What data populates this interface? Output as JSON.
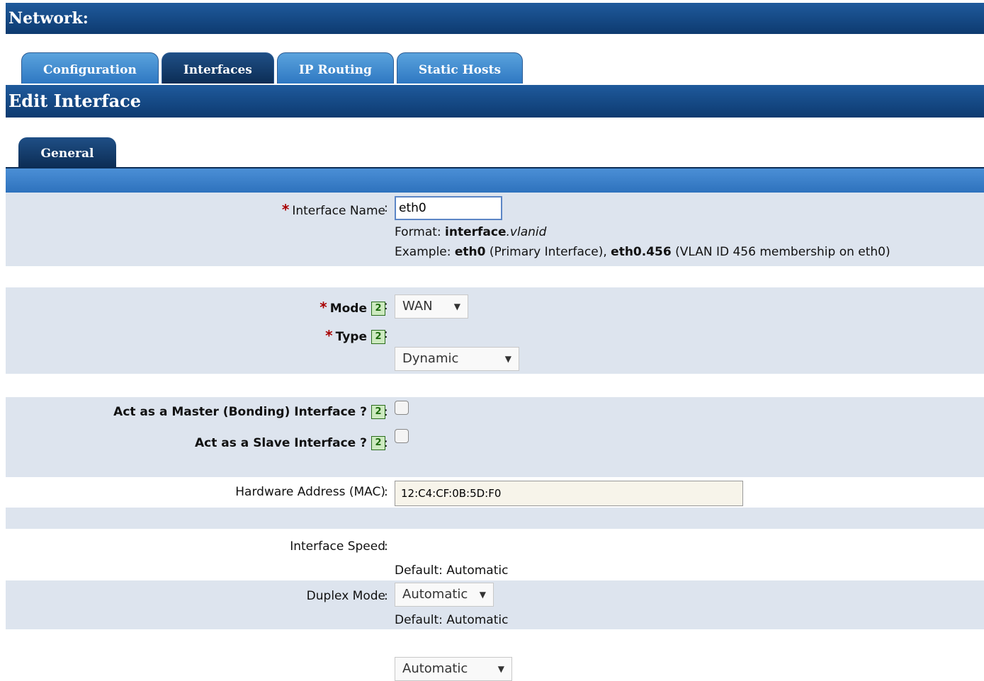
{
  "header": {
    "title": "Network:"
  },
  "tabs": [
    {
      "label": "Configuration"
    },
    {
      "label": "Interfaces"
    },
    {
      "label": "IP Routing"
    },
    {
      "label": "Static Hosts"
    }
  ],
  "edit": {
    "title": "Edit Interface",
    "subtab": "General"
  },
  "form": {
    "colon": ":",
    "required_mark": "*",
    "help_icon_glyph": "2",
    "interface_name": {
      "label": "Interface Name",
      "value": "eth0",
      "format_prefix": "Format: ",
      "format_bold": "interface",
      "format_italic": ".vlanid",
      "example_prefix": "Example: ",
      "example_1": "eth0",
      "example_1_desc": " (Primary Interface), ",
      "example_2": "eth0.456",
      "example_2_desc": " (VLAN ID 456 membership on eth0)"
    },
    "mode": {
      "label": "Mode",
      "value": "WAN"
    },
    "type": {
      "label": "Type",
      "value": "Dynamic"
    },
    "master": {
      "label": "Act as a Master (Bonding) Interface ?",
      "checked": false
    },
    "slave": {
      "label": "Act as a Slave Interface ?",
      "checked": false
    },
    "mac": {
      "label": "Hardware Address (MAC)",
      "value": "12:C4:CF:0B:5D:F0"
    },
    "speed": {
      "label": "Interface Speed",
      "value": "Automatic",
      "default": "Default: Automatic"
    },
    "duplex": {
      "label": "Duplex Mode",
      "value": "Automatic",
      "default": "Default: Automatic"
    }
  },
  "select_arrow_glyph": "▼"
}
